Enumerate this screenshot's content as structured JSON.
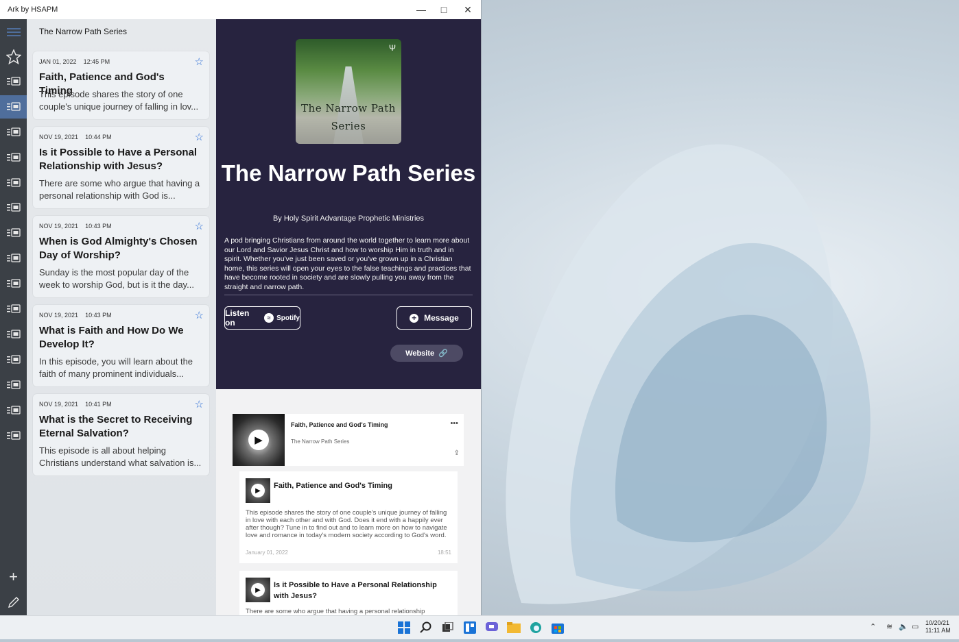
{
  "window": {
    "title": "Ark by HSAPM"
  },
  "list": {
    "header": "The Narrow Path Series",
    "episodes": [
      {
        "date": "JAN 01, 2022",
        "time": "12:45 PM",
        "title": "Faith, Patience and God's Timing",
        "desc": "This episode shares the story of one couple's unique journey of falling in lov..."
      },
      {
        "date": "NOV 19, 2021",
        "time": "10:44 PM",
        "title": "Is it Possible to Have a Personal Relationship with Jesus?",
        "desc": "There are some who argue that having a personal relationship with God is..."
      },
      {
        "date": "NOV 19, 2021",
        "time": "10:43 PM",
        "title": "When is God Almighty's Chosen Day of Worship?",
        "desc": "Sunday is the most popular day of the week to worship God, but is it the day..."
      },
      {
        "date": "NOV 19, 2021",
        "time": "10:43 PM",
        "title": "What is Faith and How Do We Develop It?",
        "desc": "In this episode, you will learn about the faith of many prominent individuals..."
      },
      {
        "date": "NOV 19, 2021",
        "time": "10:41 PM",
        "title": "What is the Secret to Receiving Eternal Salvation?",
        "desc": "This episode is all about helping Christians understand what salvation is..."
      }
    ]
  },
  "show": {
    "cover_text": "The Narrow Path Series",
    "title": "The Narrow Path Series",
    "author": "By Holy Spirit Advantage Prophetic Ministries",
    "description": "A pod bringing Christians from around the world together to learn more about our Lord and Savior Jesus Christ and how to worship Him in truth and in spirit. Whether you've just been saved or you've grown up in a Christian home, this series will open your eyes to the false teachings and practices that have become rooted in society and are slowly pulling you away from the straight and narrow path.",
    "listen_label": "Listen on",
    "spotify_label": "Spotify",
    "message_label": "Message",
    "website_label": "Website"
  },
  "player": {
    "title": "Faith, Patience and God's Timing",
    "subtitle": "The Narrow Path Series",
    "more": "•••"
  },
  "embed_episodes": [
    {
      "title": "Faith, Patience and God's Timing",
      "desc": "This episode shares the story of one couple's unique journey of falling in love with each other and with God. Does it end with a happily ever after though? Tune in to find out and to learn more on how to navigate love and romance in today's modern society according to God's word.",
      "date": "January 01, 2022",
      "duration": "18:51"
    },
    {
      "title": "Is it Possible to Have a Personal Relationship with Jesus?",
      "desc": "There are some who argue that having a personal relationship"
    }
  ],
  "tray": {
    "date": "10/20/21",
    "time": "11:11 AM"
  },
  "colors": {
    "hero": "#27233f",
    "rail": "#3b4046",
    "accent": "#4f6e9c",
    "star": "#2e6fd6"
  }
}
